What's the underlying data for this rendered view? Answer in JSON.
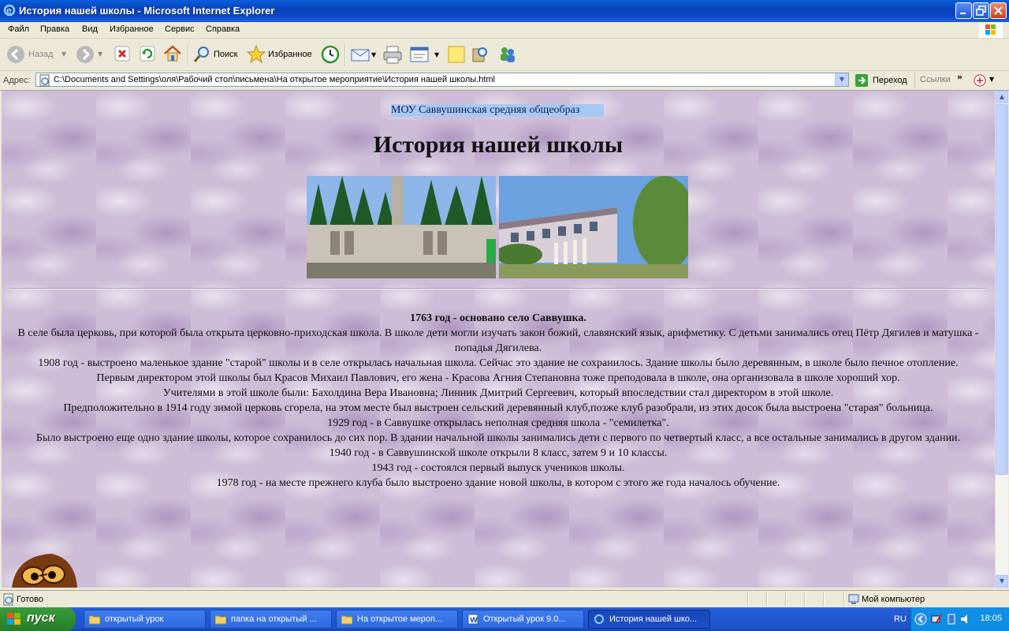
{
  "window": {
    "title": "История нашей школы - Microsoft Internet Explorer"
  },
  "menu": [
    "Файл",
    "Правка",
    "Вид",
    "Избранное",
    "Сервис",
    "Справка"
  ],
  "toolbar": {
    "back_label": "Назад",
    "search_label": "Поиск",
    "favorites_label": "Избранное"
  },
  "address": {
    "label": "Адрес:",
    "value": "C:\\Documents and Settings\\оля\\Рабочий стол\\письмена\\На открытое мероприятие\\История нашей школы.html",
    "go_label": "Переход",
    "links_label": "Ссылки"
  },
  "page": {
    "marquee": "МОУ Саввушинская средняя общеобраз",
    "heading": "История нашей школы",
    "intro_bold": "1763 год - основано село Саввушка.",
    "paragraphs": [
      "В селе была церковь, при которой была открыта церковно-приходская школа. В школе дети могли изучать закон божий, славянский язык, арифметику. С детьми занимались отец Пётр Дягилев и матушка - попадья Дягилева.",
      "1908 год - выстроено маленькое здание \"старой\" школы и в селе открылась начальная школа. Сейчас это здание не сохранилось. Здание школы было деревянным, в школе было печное отопление.",
      "Первым директором этой школы был Красов Михаил Павлович, его жена - Красова Агния Степановна тоже преподовала в школе, она организовала в школе хороший хор.",
      "Учителями в этой школе были: Бахолдина Вера Ивановна; Линник Дмитрий Сергеевич, который впоследствии стал директором в этой школе.",
      "Предположительно в 1914 году зимой церковь сгорела, на этом месте был выстроен сельский деревянный клуб,позже клуб разобрали, из этих досок была выстроена \"старая\" больница.",
      "1929 год - в Саввушке открылась неполная средняя школа - \"семилетка\".",
      "Было выстроено еще одно здание школы, которое сохранилось до сих пор. В здании начальной школы занимались дети с первого по четвертый класс, а все остальные занимались в другом здании.",
      "1940 год - в Саввушинской школе открыли 8 класс, затем 9 и 10 классы.",
      "1943 год - состоялся первый выпуск учеников школы.",
      "1978 год - на месте прежнего клуба было выстроено здание новой школы, в котором с этого же года началось обучение."
    ]
  },
  "status": {
    "text": "Готово",
    "zone": "Мой компьютер"
  },
  "taskbar": {
    "start_label": "пуск",
    "tasks": [
      "открытый урок",
      "папка на открытый ...",
      "На открытое мероп...",
      "Открытый урок 9.0...",
      "История нашей шко..."
    ],
    "lang": "RU",
    "clock": "18:05"
  },
  "colors": {
    "titlebar": "#0842b8",
    "page_background": "#cdbdd8",
    "marquee_highlight": "#a6c9f3",
    "taskbar": "#245edb",
    "start": "#2f8f2f"
  }
}
